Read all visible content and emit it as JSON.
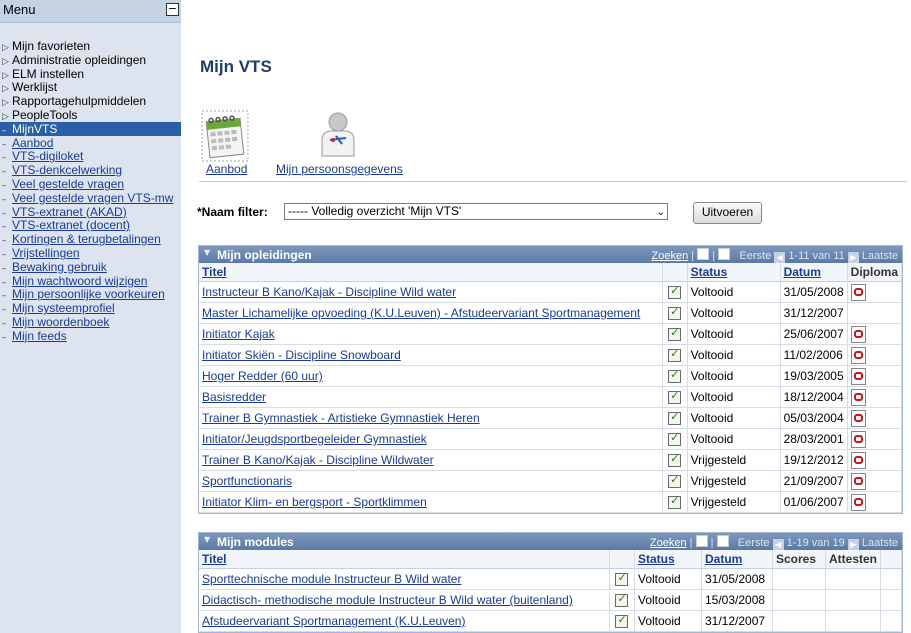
{
  "menu": {
    "title": "Menu",
    "collapse_glyph": "−",
    "items": [
      {
        "label": "Mijn favorieten",
        "type": "folder"
      },
      {
        "label": "Administratie opleidingen",
        "type": "folder"
      },
      {
        "label": "ELM instellen",
        "type": "folder"
      },
      {
        "label": "Werklijst",
        "type": "folder"
      },
      {
        "label": "Rapportagehulpmiddelen",
        "type": "folder"
      },
      {
        "label": "PeopleTools",
        "type": "folder"
      },
      {
        "label": "MijnVTS",
        "type": "active"
      },
      {
        "label": "Aanbod",
        "type": "link"
      },
      {
        "label": "VTS-digiloket",
        "type": "link"
      },
      {
        "label": "VTS-denkcelwerking",
        "type": "link"
      },
      {
        "label": "Veel gestelde vragen",
        "type": "link"
      },
      {
        "label": "Veel gestelde vragen VTS-mw",
        "type": "link"
      },
      {
        "label": "VTS-extranet (AKAD)",
        "type": "link"
      },
      {
        "label": "VTS-extranet (docent)",
        "type": "link"
      },
      {
        "label": "Kortingen & terugbetalingen",
        "type": "link"
      },
      {
        "label": "Vrijstellingen",
        "type": "link"
      },
      {
        "label": "Bewaking gebruik",
        "type": "link"
      },
      {
        "label": "Mijn wachtwoord wijzigen",
        "type": "link"
      },
      {
        "label": "Mijn persoonlijke voorkeuren",
        "type": "link"
      },
      {
        "label": "Mijn systeemprofiel",
        "type": "link"
      },
      {
        "label": "Mijn woordenboek",
        "type": "link"
      },
      {
        "label": "Mijn feeds",
        "type": "link"
      }
    ]
  },
  "page": {
    "title": "Mijn VTS",
    "tiles": {
      "aanbod": "Aanbod",
      "personal": "Mijn persoonsgegevens"
    },
    "filter": {
      "label": "*Naam filter:",
      "value": "----- Volledig overzicht 'Mijn VTS'",
      "button": "Uitvoeren"
    }
  },
  "opleidingen": {
    "title": "Mijn opleidingen",
    "nav": {
      "find": "Zoeken",
      "first": "Eerste",
      "range": "1-11 van 11",
      "last": "Laatste"
    },
    "columns": {
      "title": "Titel",
      "status": "Status",
      "date": "Datum",
      "diploma": "Diploma"
    },
    "rows": [
      {
        "title": "Instructeur B Kano/Kajak - Discipline Wild water",
        "status": "Voltooid",
        "date": "31/05/2008",
        "diploma": true
      },
      {
        "title": "Master Lichamelijke opvoeding (K.U.Leuven) - Afstudeervariant Sportmanagement",
        "status": "Voltooid",
        "date": "31/12/2007",
        "diploma": false
      },
      {
        "title": "Initiator Kajak",
        "status": "Voltooid",
        "date": "25/06/2007",
        "diploma": true
      },
      {
        "title": "Initiator Skiën - Discipline Snowboard",
        "status": "Voltooid",
        "date": "11/02/2006",
        "diploma": true
      },
      {
        "title": "Hoger Redder (60 uur)",
        "status": "Voltooid",
        "date": "19/03/2005",
        "diploma": true
      },
      {
        "title": "Basisredder",
        "status": "Voltooid",
        "date": "18/12/2004",
        "diploma": true
      },
      {
        "title": "Trainer B Gymnastiek - Artistieke Gymnastiek Heren",
        "status": "Voltooid",
        "date": "05/03/2004",
        "diploma": true
      },
      {
        "title": "Initiator/Jeugdsportbegeleider Gymnastiek",
        "status": "Voltooid",
        "date": "28/03/2001",
        "diploma": true
      },
      {
        "title": "Trainer B Kano/Kajak - Discipline Wildwater",
        "status": "Vrijgesteld",
        "date": "19/12/2012",
        "diploma": true
      },
      {
        "title": "Sportfunctionaris",
        "status": "Vrijgesteld",
        "date": "21/09/2007",
        "diploma": true
      },
      {
        "title": "Initiator Klim- en bergsport - Sportklimmen",
        "status": "Vrijgesteld",
        "date": "01/06/2007",
        "diploma": true
      }
    ]
  },
  "modules": {
    "title": "Mijn modules",
    "nav": {
      "find": "Zoeken",
      "first": "Eerste",
      "range": "1-19 van 19",
      "last": "Laatste"
    },
    "columns": {
      "title": "Titel",
      "status": "Status",
      "date": "Datum",
      "scores": "Scores",
      "attests": "Attesten"
    },
    "rows": [
      {
        "title": "Sporttechnische module Instructeur B Wild water",
        "status": "Voltooid",
        "date": "31/05/2008"
      },
      {
        "title": "Didactisch- methodische module Instructeur B Wild water (buitenland)",
        "status": "Voltooid",
        "date": "15/03/2008"
      },
      {
        "title": "Afstudeervariant Sportmanagement (K.U.Leuven)",
        "status": "Voltooid",
        "date": "31/12/2007"
      }
    ]
  }
}
